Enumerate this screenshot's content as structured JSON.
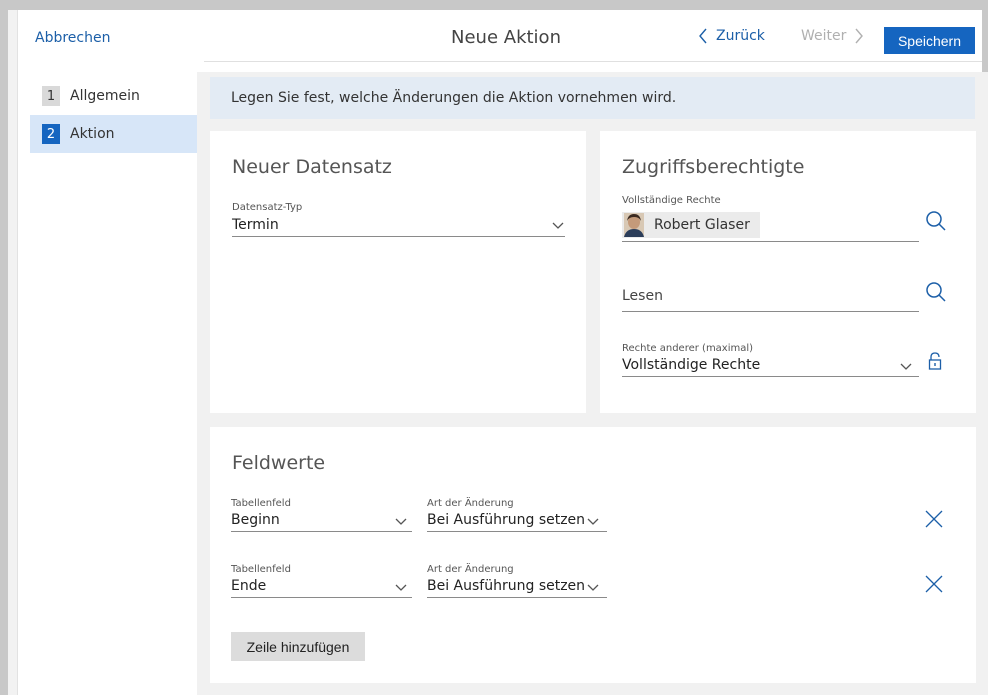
{
  "header": {
    "cancel_label": "Abbrechen",
    "title": "Neue Aktion",
    "back_label": "Zurück",
    "next_label": "Weiter",
    "save_label": "Speichern"
  },
  "sidebar": {
    "items": [
      {
        "num": "1",
        "label": "Allgemein",
        "active": false
      },
      {
        "num": "2",
        "label": "Aktion",
        "active": true
      }
    ]
  },
  "banner": {
    "text": "Legen Sie fest, welche Änderungen die Aktion vornehmen wird."
  },
  "new_record": {
    "title": "Neuer Datensatz",
    "type_label": "Datensatz-Typ",
    "type_value": "Termin"
  },
  "access": {
    "title": "Zugriffsberechtigte",
    "full_rights_label": "Vollständige Rechte",
    "full_rights_person": "Robert Glaser",
    "read_placeholder": "Lesen",
    "others_label": "Rechte anderer (maximal)",
    "others_value": "Vollständige Rechte"
  },
  "field_values": {
    "title": "Feldwerte",
    "rows": [
      {
        "field_label": "Tabellenfeld",
        "field_value": "Beginn",
        "change_label": "Art der Änderung",
        "change_value": "Bei Ausführung setzen"
      },
      {
        "field_label": "Tabellenfeld",
        "field_value": "Ende",
        "change_label": "Art der Änderung",
        "change_value": "Bei Ausführung setzen"
      }
    ],
    "add_row_label": "Zeile hinzufügen"
  },
  "colors": {
    "accent": "#1565c0",
    "link": "#1c5fa8",
    "active_nav": "#d7e6f8",
    "banner": "#e3ebf4"
  },
  "icons": {
    "back": "chevron-left-icon",
    "next": "chevron-right-icon",
    "search": "search-icon",
    "lock": "lock-icon",
    "dropdown": "chevron-down-icon",
    "remove": "close-icon"
  }
}
